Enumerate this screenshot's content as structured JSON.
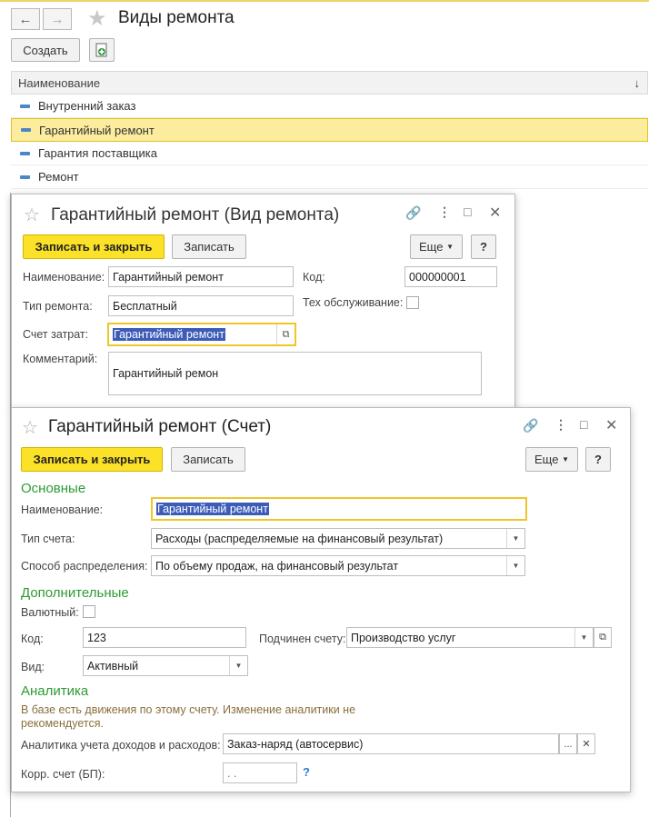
{
  "main": {
    "title": "Виды ремонта",
    "create_label": "Создать",
    "column_header": "Наименование",
    "rows": [
      "Внутренний заказ",
      "Гарантийный ремонт",
      "Гарантия поставщика",
      "Ремонт"
    ]
  },
  "repair_form": {
    "title": "Гарантийный ремонт (Вид ремонта)",
    "save_close": "Записать и закрыть",
    "save": "Записать",
    "more": "Еще",
    "help": "?",
    "name_label": "Наименование:",
    "name_value": "Гарантийный ремонт",
    "code_label": "Код:",
    "code_value": "000000001",
    "type_label": "Тип ремонта:",
    "type_value": "Бесплатный",
    "service_label": "Тех обслуживание:",
    "cost_label": "Счет затрат:",
    "cost_value": "Гарантийный ремонт",
    "comment_label": "Комментарий:",
    "comment_value": "Гарантийный ремон"
  },
  "account_form": {
    "title": "Гарантийный ремонт (Счет)",
    "save_close": "Записать и закрыть",
    "save": "Записать",
    "more": "Еще",
    "help": "?",
    "section_main": "Основные",
    "name_label": "Наименование:",
    "name_value": "Гарантийный ремонт",
    "acctype_label": "Тип счета:",
    "acctype_value": "Расходы (распределяемые на финансовый результат)",
    "dist_label": "Способ распределения:",
    "dist_value": "По объему продаж, на финансовый результат",
    "section_extra": "Дополнительные",
    "currency_label": "Валютный:",
    "code_label": "Код:",
    "code_value": "123",
    "parent_label": "Подчинен счету:",
    "parent_value": "Производство услуг",
    "kind_label": "Вид:",
    "kind_value": "Активный",
    "section_analytics": "Аналитика",
    "note": "В базе есть движения по этому счету. Изменение аналитики не рекомендуется.",
    "analytics_label": "Аналитика учета доходов и расходов:",
    "analytics_value": "Заказ-наряд (автосервис)",
    "corr_label": "Корр. счет (БП):",
    "corr_value": ". .",
    "help_q": "?"
  },
  "colors": {
    "accent_yellow": "#fbe128",
    "section_green": "#2e9b34",
    "selection": "#3c5cb8"
  }
}
